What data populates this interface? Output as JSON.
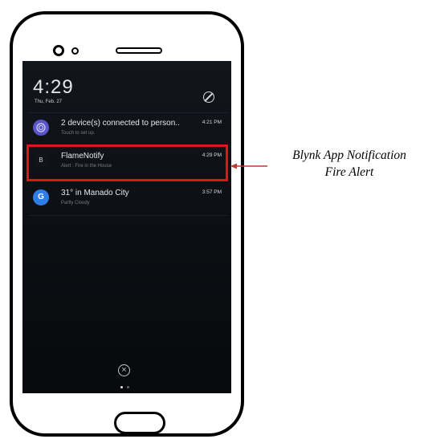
{
  "lockscreen": {
    "time": "4:29",
    "date": "Thu, Feb. 27"
  },
  "notifications": [
    {
      "icon": "link-icon",
      "icon_color": "#5a56c9",
      "title": "2 device(s) connected to person..",
      "subtitle": "Touch to set up.",
      "time": "4:21 PM"
    },
    {
      "icon": "blynk-icon",
      "icon_color": "#111318",
      "icon_letter": "B",
      "title": "FlameNotify",
      "subtitle": "Alert : Fire in the House",
      "time": "4:29 PM"
    },
    {
      "icon": "google-icon",
      "icon_color": "#2f7ee8",
      "icon_letter": "G",
      "title": "31° in Manado City",
      "subtitle": "Partly Cloudy",
      "time": "3:57 PM"
    }
  ],
  "annotation": {
    "line1": "Blynk App Notification",
    "line2": "Fire Alert",
    "color": "#e0141b"
  }
}
